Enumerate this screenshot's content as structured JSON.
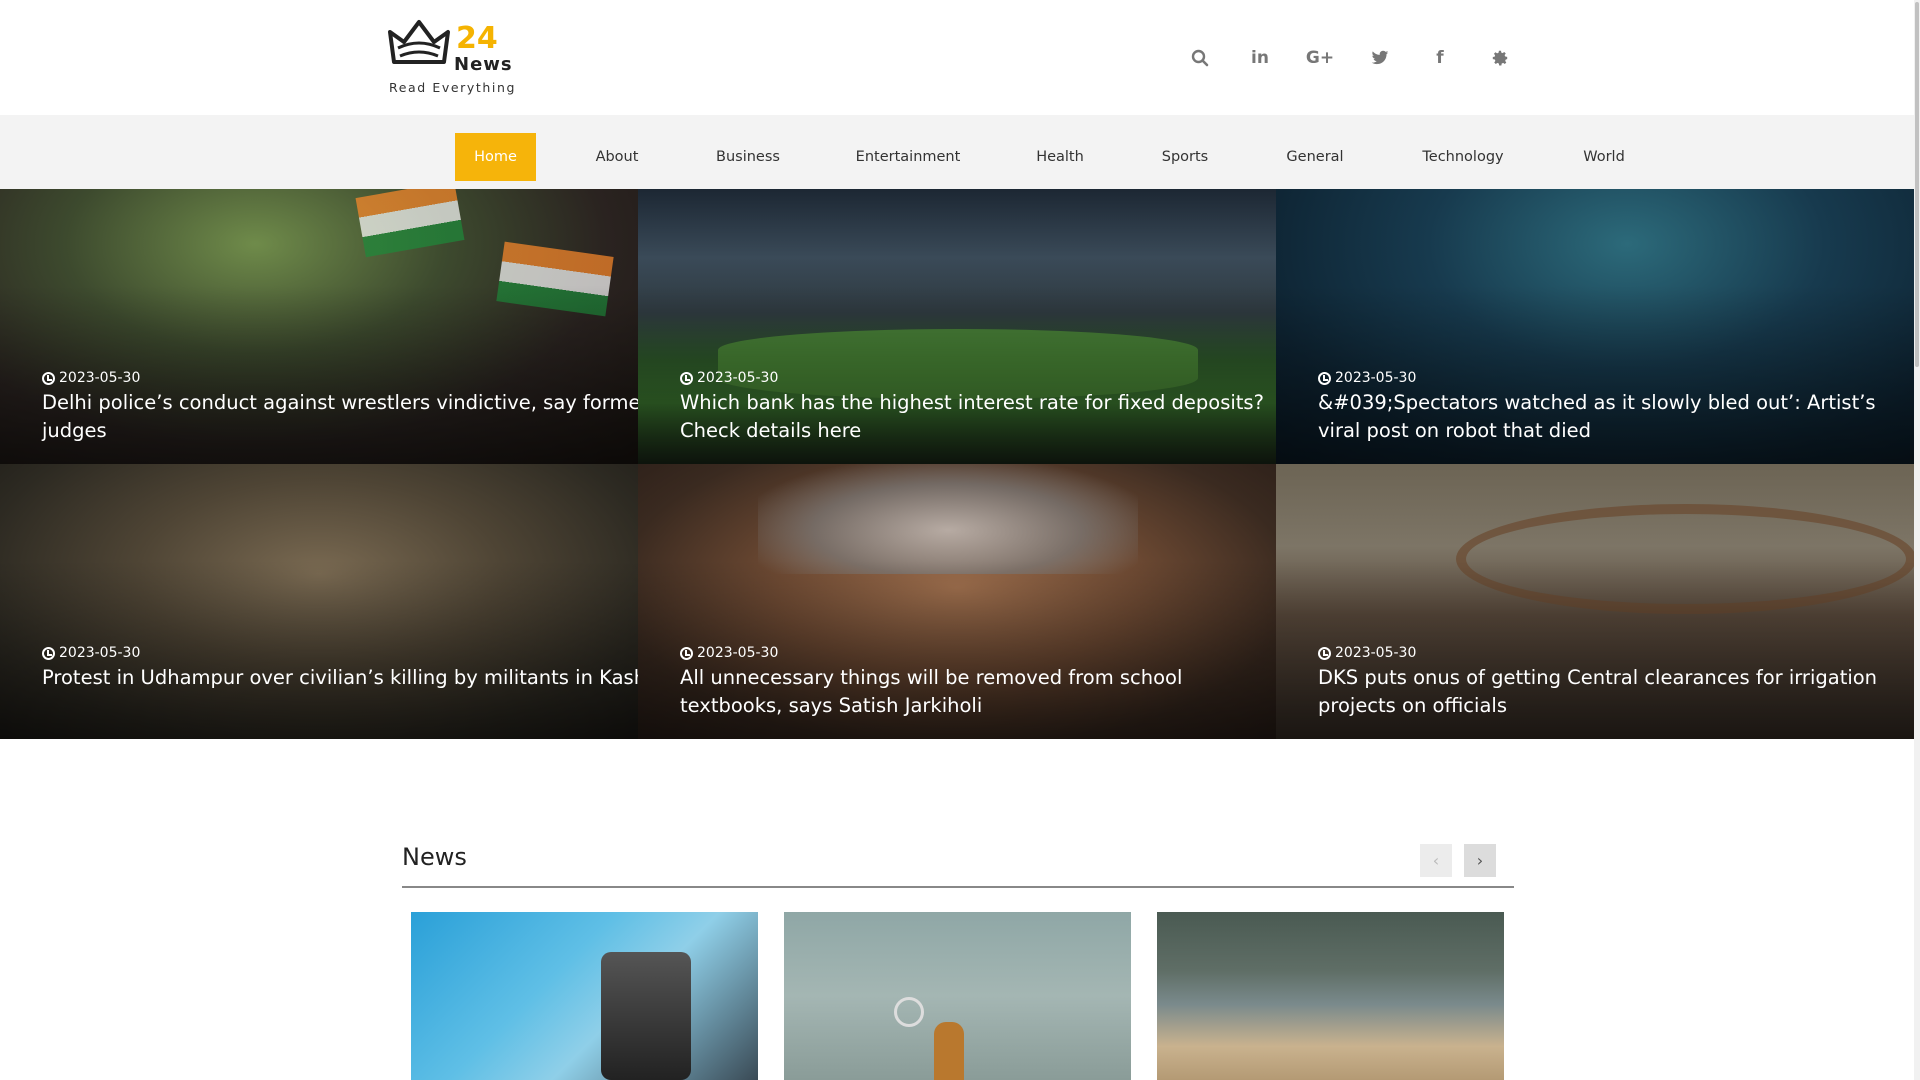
{
  "brand": {
    "number": "24",
    "word": "News",
    "tagline": "Read Everything",
    "accent": "#f6b40a"
  },
  "social": [
    {
      "icon": "search-icon",
      "glyph": "⌕"
    },
    {
      "icon": "linkedin-icon",
      "glyph": "in"
    },
    {
      "icon": "google-plus-icon",
      "glyph": "G+"
    },
    {
      "icon": "twitter-icon",
      "glyph": "🐦"
    },
    {
      "icon": "facebook-icon",
      "glyph": "f"
    },
    {
      "icon": "gear-icon",
      "glyph": "⚙"
    }
  ],
  "nav": {
    "items": [
      {
        "label": "Home",
        "active": true
      },
      {
        "label": "About"
      },
      {
        "label": "Business"
      },
      {
        "label": "Entertainment"
      },
      {
        "label": "Health"
      },
      {
        "label": "Sports"
      },
      {
        "label": "General"
      },
      {
        "label": "Technology"
      },
      {
        "label": "World"
      }
    ]
  },
  "hero": [
    {
      "date": "2023-05-30",
      "title": "Delhi police’s conduct against wrestlers vindictive, say former S"
    },
    {
      "date": "2023-05-30",
      "title": "Which bank has the highest interest rate for fixed deposits? Check details here"
    },
    {
      "date": "2023-05-30",
      "title": "&#039;Spectators watched as it slowly bled out’: Artist’s viral post on robot that died"
    },
    {
      "date": "2023-05-30",
      "title": "Protest in Udhampur over civilian’s killing by militants in Kashmi"
    },
    {
      "date": "2023-05-30",
      "title": "All unnecessary things will be removed from school textbooks, says Satish Jarkiholi"
    },
    {
      "date": "2023-05-30",
      "title": "DKS puts onus of getting Central clearances for irrigation projects on officials"
    }
  ],
  "hero_extra": {
    "first_line2": "judges"
  },
  "news": {
    "heading": "News",
    "prev": "‹",
    "next": "›"
  }
}
